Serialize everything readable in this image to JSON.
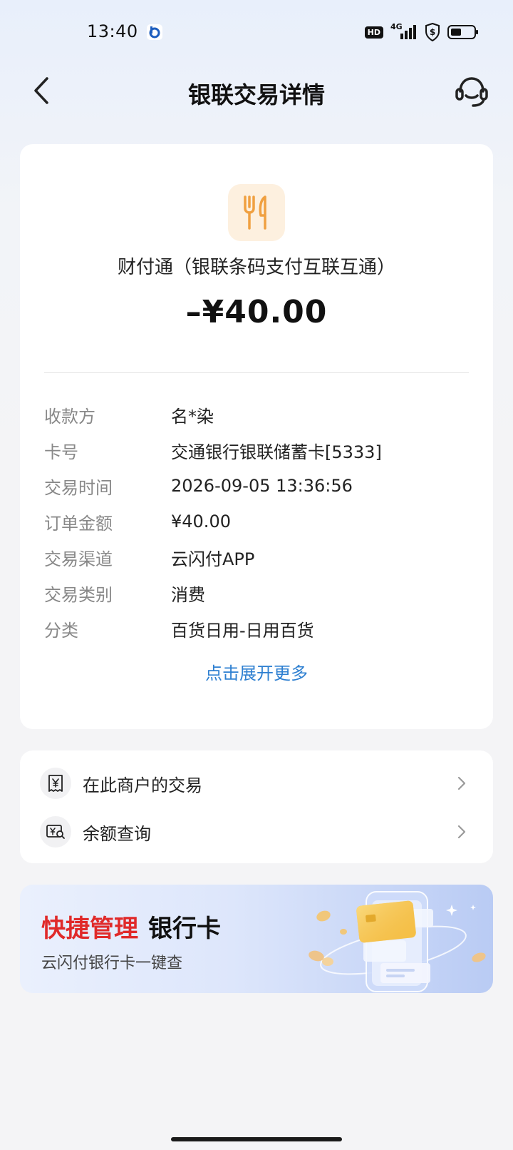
{
  "status_bar": {
    "time": "13:40",
    "hd": "HD",
    "network": "4G"
  },
  "header": {
    "title": "银联交易详情"
  },
  "transaction": {
    "merchant_name": "财付通（银联条码支付互联互通）",
    "amount": "–¥40.00",
    "details": [
      {
        "label": "收款方",
        "value": "名*染"
      },
      {
        "label": "卡号",
        "value": "交通银行银联储蓄卡[5333]"
      },
      {
        "label": "交易时间",
        "value": "2026-09-05 13:36:56"
      },
      {
        "label": "订单金额",
        "value": "¥40.00"
      },
      {
        "label": "交易渠道",
        "value": "云闪付APP"
      },
      {
        "label": "交易类别",
        "value": "消费"
      },
      {
        "label": "分类",
        "value": "百货日用-日用百货"
      }
    ],
    "expand_label": "点击展开更多"
  },
  "links": [
    {
      "label": "在此商户的交易",
      "icon": "receipt-yen-icon"
    },
    {
      "label": "余额查询",
      "icon": "balance-search-icon"
    }
  ],
  "banner": {
    "title_red": "快捷管理",
    "title_black": "银行卡",
    "subtitle": "云闪付银行卡一键查"
  },
  "colors": {
    "accent_blue": "#2f80d1",
    "accent_red": "#e02a2a",
    "merchant_icon_orange": "#f0a040"
  }
}
